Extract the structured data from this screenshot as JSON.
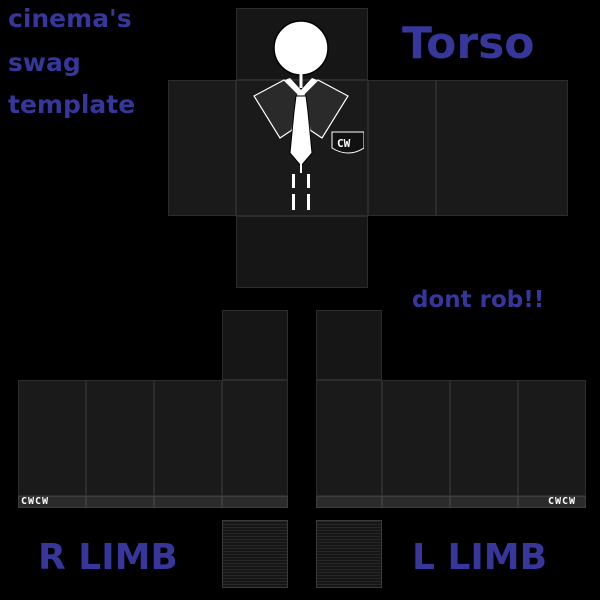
{
  "labels": {
    "credit_line1": "cinema's",
    "credit_line2": "swag",
    "credit_line3": "template",
    "torso": "Torso",
    "warning": "dont rob!!",
    "right_limb": "R LIMB",
    "left_limb": "L LIMB"
  },
  "tags": {
    "chest_logo": "CW",
    "right_cuff": "CWCW",
    "left_cuff": "CWCW"
  },
  "icons": {
    "figure": "stick-figure-in-suit-icon",
    "chest_badge": "pocket-badge-icon"
  },
  "colors": {
    "background": "#000000",
    "label_text": "#37369a",
    "panel": "#1a1a1a",
    "shirt": "#ffffff"
  }
}
